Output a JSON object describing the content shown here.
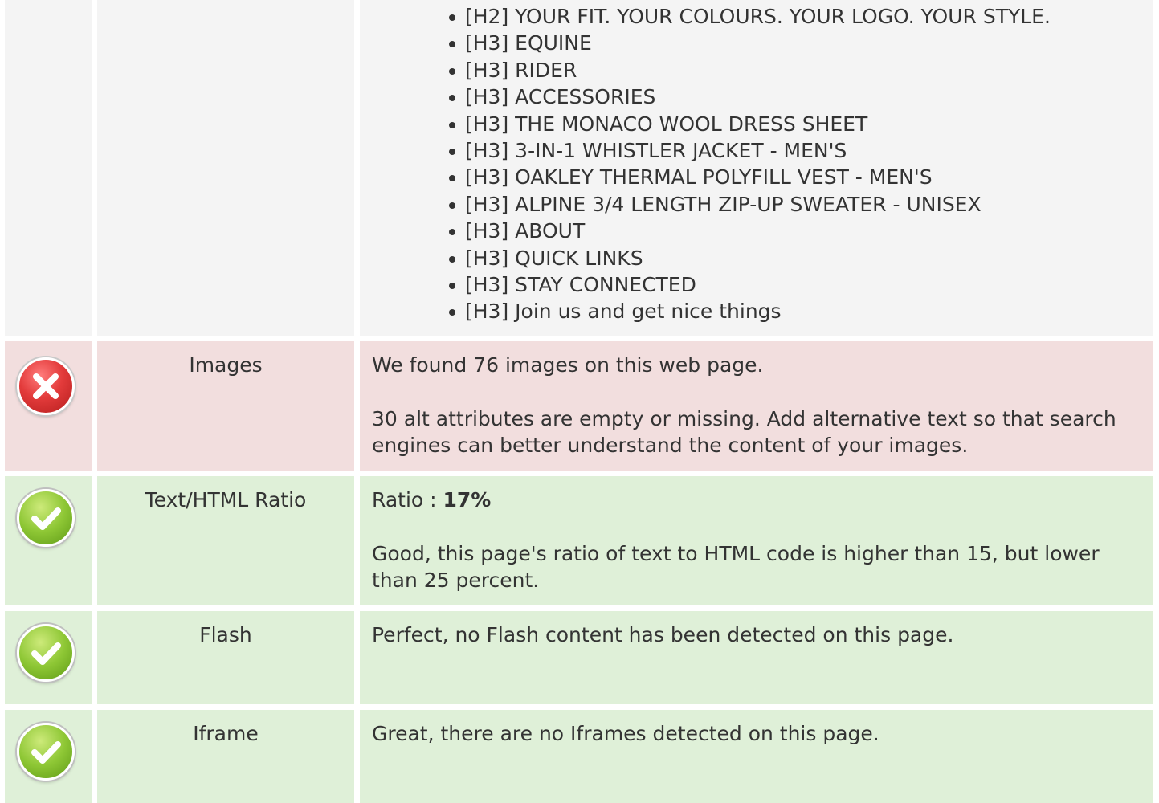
{
  "headings": {
    "items": [
      "[H2] YOUR FIT. YOUR COLOURS. YOUR LOGO. YOUR STYLE.",
      "[H3] EQUINE",
      "[H3] RIDER",
      "[H3] ACCESSORIES",
      "[H3] THE MONACO WOOL DRESS SHEET",
      "[H3] 3-IN-1 WHISTLER JACKET - MEN'S",
      "[H3] OAKLEY THERMAL POLYFILL VEST - MEN'S",
      "[H3] ALPINE 3/4 LENGTH ZIP-UP SWEATER - UNISEX",
      "[H3] ABOUT",
      "[H3] QUICK LINKS",
      "[H3] STAY CONNECTED",
      "[H3] Join us and get nice things"
    ]
  },
  "checks": {
    "images": {
      "label": "Images",
      "status_icon": "error-icon",
      "text1": "We found 76 images on this web page.",
      "text2": "30 alt attributes are empty or missing. Add alternative text so that search engines can better understand the content of your images."
    },
    "ratio": {
      "label": "Text/HTML Ratio",
      "status_icon": "check-icon",
      "prefix": "Ratio : ",
      "value": "17%",
      "text2": "Good, this page's ratio of text to HTML code is higher than 15, but lower than 25 percent."
    },
    "flash": {
      "label": "Flash",
      "status_icon": "check-icon",
      "text1": "Perfect, no Flash content has been detected on this page."
    },
    "iframe": {
      "label": "Iframe",
      "status_icon": "check-icon",
      "text1": "Great, there are no Iframes detected on this page."
    }
  },
  "colors": {
    "neutral_bg": "#f4f4f4",
    "error_bg": "#f2dede",
    "success_bg": "#dff0d8",
    "text": "#333333"
  }
}
